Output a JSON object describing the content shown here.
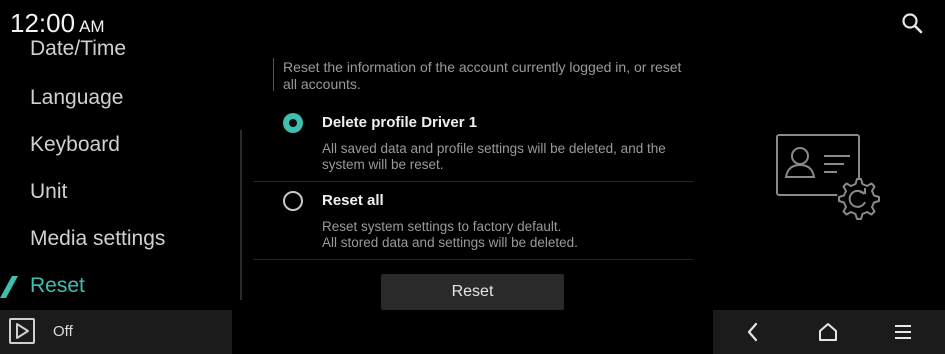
{
  "status_bar": {
    "time": "12:00",
    "ampm": "AM",
    "search_icon": "search-icon"
  },
  "menu": {
    "items": [
      {
        "label": "Date/Time",
        "active": false
      },
      {
        "label": "Language",
        "active": false
      },
      {
        "label": "Keyboard",
        "active": false
      },
      {
        "label": "Unit",
        "active": false
      },
      {
        "label": "Media settings",
        "active": false
      },
      {
        "label": "Reset",
        "active": true
      }
    ],
    "accent_color": "#3fbfb0"
  },
  "content": {
    "info_text": "Reset the information of the account currently logged in, or reset all accounts.",
    "options": [
      {
        "title": "Delete profile Driver 1",
        "description": "All saved data and profile settings will be deleted, and the system will be reset.",
        "selected": true
      },
      {
        "title": "Reset all",
        "description_line1": "Reset system settings to factory default.",
        "description_line2": "All stored data and settings will be deleted.",
        "selected": false
      }
    ],
    "reset_button": "Reset",
    "illustration_icon": "profile-reset-icon"
  },
  "media_bar": {
    "status": "Off",
    "play_icon": "play-icon"
  },
  "nav_bar": {
    "icons": [
      "back-icon",
      "home-icon",
      "menu-icon"
    ]
  }
}
